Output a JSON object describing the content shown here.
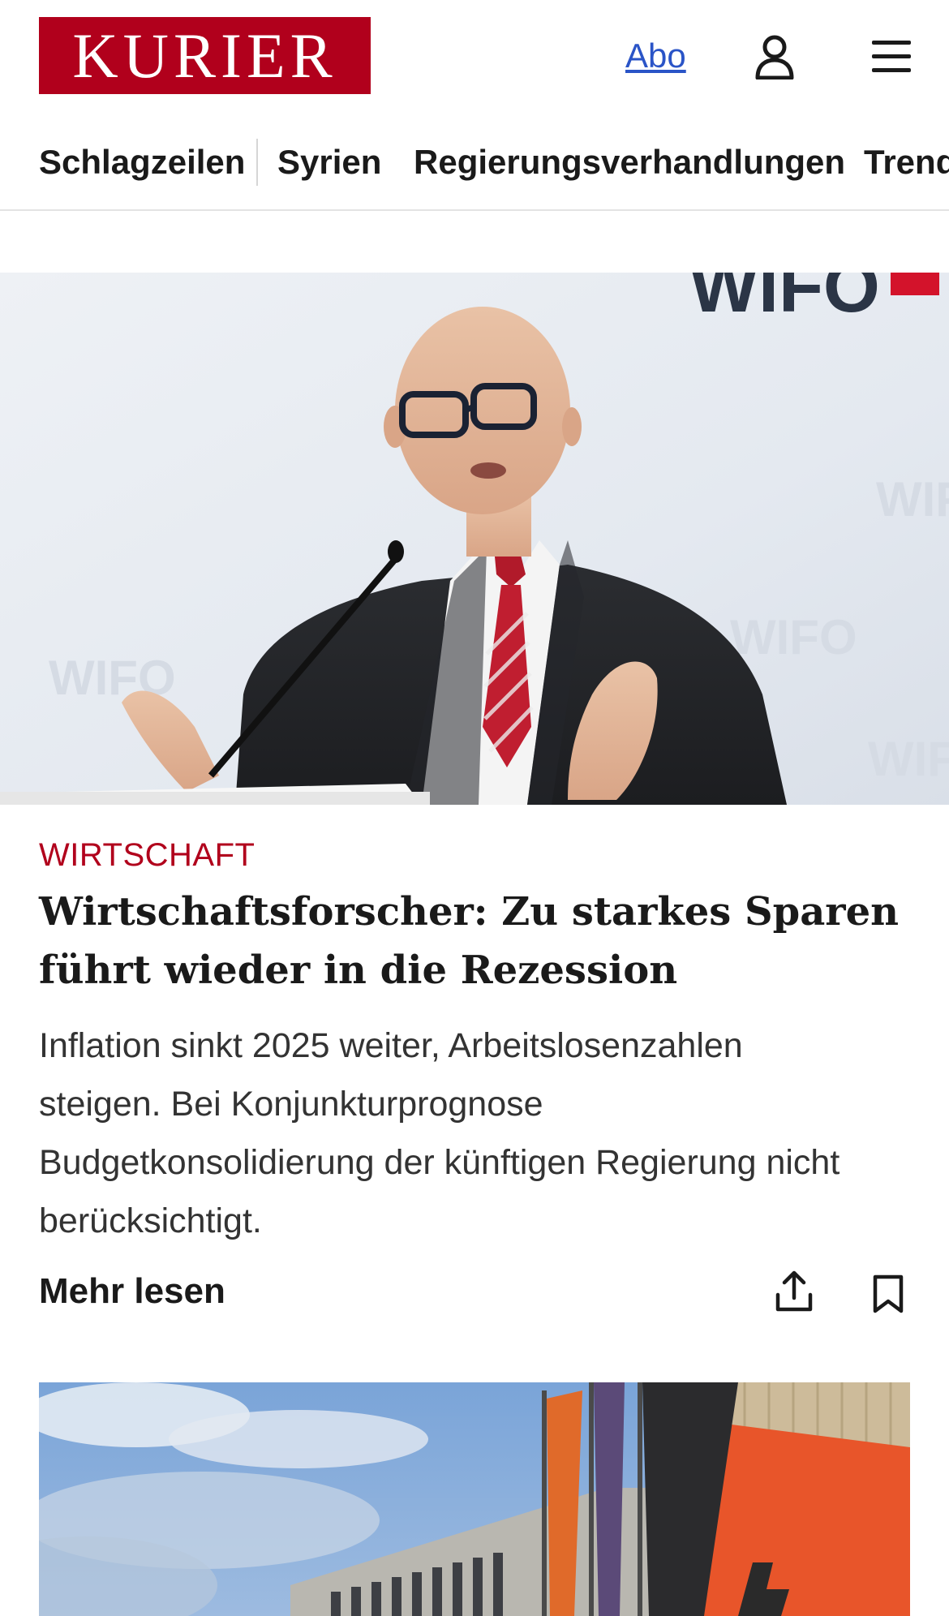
{
  "header": {
    "logo_text": "KURIER",
    "abo_label": "Abo",
    "user_icon": "user-icon",
    "menu_icon": "hamburger-menu-icon"
  },
  "nav": {
    "items": [
      {
        "label": "Schlagzeilen"
      },
      {
        "label": "Syrien"
      },
      {
        "label": "Regierungsverhandlungen"
      },
      {
        "label": "Trend"
      }
    ]
  },
  "article": {
    "category": "WIRTSCHAFT",
    "headline": "Wirtschaftsforscher: Zu starkes Sparen führt wieder in die Rezession",
    "teaser": "Inflation sinkt 2025 weiter, Arbeitslosenzahlen steigen. Bei Konjunkturprognose Budgetkonsolidierung der künftigen Regierung nicht berücksichtigt.",
    "more_label": "Mehr lesen",
    "share_icon": "share-icon",
    "bookmark_icon": "bookmark-icon",
    "image_text": "WIFO"
  },
  "colors": {
    "brand_red": "#b1001c",
    "link_blue": "#2a54c7",
    "text_dark": "#1a1a1a"
  }
}
